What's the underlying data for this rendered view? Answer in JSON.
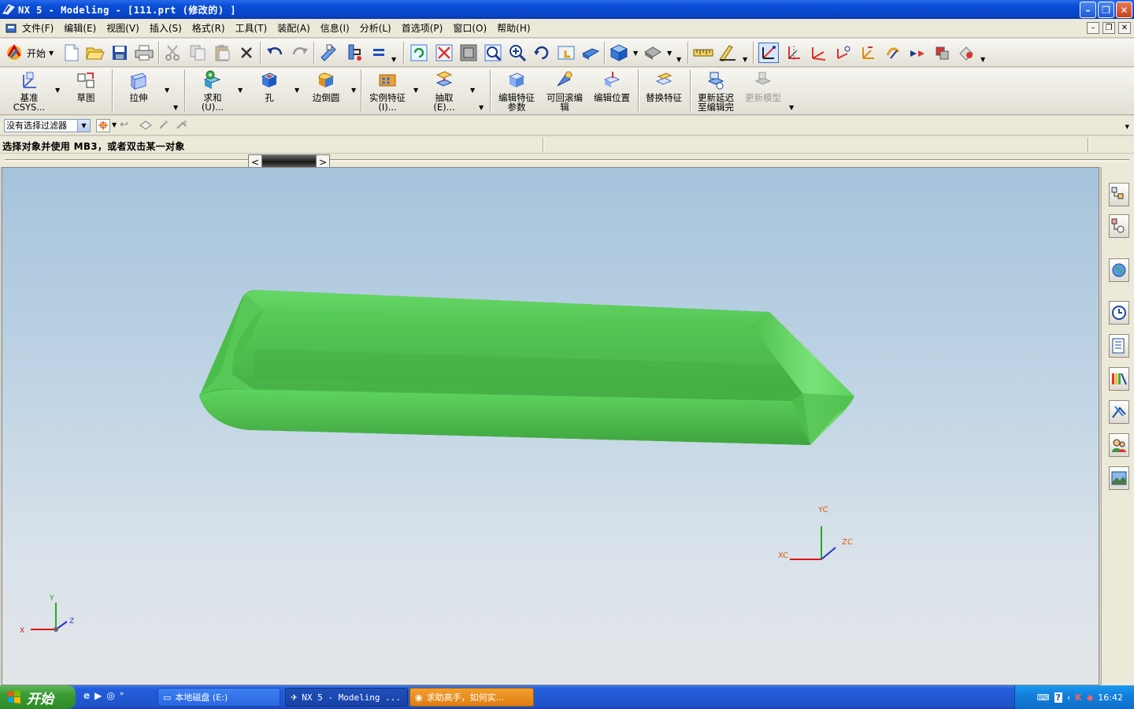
{
  "window": {
    "title": "NX 5 - Modeling - [111.prt  (修改的) ]",
    "buttons": [
      "minimize",
      "restore",
      "close"
    ]
  },
  "menubar": {
    "items": [
      "文件(F)",
      "编辑(E)",
      "视图(V)",
      "插入(S)",
      "格式(R)",
      "工具(T)",
      "装配(A)",
      "信息(I)",
      "分析(L)",
      "首选项(P)",
      "窗口(O)",
      "帮助(H)"
    ]
  },
  "toolbar_standard": {
    "start_label": "开始"
  },
  "toolbar_features": {
    "items": [
      {
        "label": "基准\nCSYS...",
        "icon": "datum-csys-icon"
      },
      {
        "label": "草图",
        "icon": "sketch-icon"
      },
      {
        "label": "拉伸",
        "icon": "extrude-icon"
      },
      {
        "label": "求和\n(U)...",
        "icon": "unite-icon"
      },
      {
        "label": "孔",
        "icon": "hole-icon"
      },
      {
        "label": "边倒圆",
        "icon": "edge-blend-icon"
      },
      {
        "label": "实例特征\n(I)...",
        "icon": "instance-feature-icon"
      },
      {
        "label": "抽取\n(E)...",
        "icon": "extract-icon"
      },
      {
        "label": "编辑特征\n参数",
        "icon": "edit-feature-params-icon"
      },
      {
        "label": "可回滚编\n辑",
        "icon": "rollback-edit-icon"
      },
      {
        "label": "编辑位置",
        "icon": "edit-position-icon"
      },
      {
        "label": "替换特征",
        "icon": "replace-feature-icon"
      },
      {
        "label": "更新延迟\n至编辑完",
        "icon": "delay-update-icon"
      },
      {
        "label": "更新模型",
        "icon": "update-model-icon",
        "disabled": true
      }
    ]
  },
  "selection": {
    "filter_value": "没有选择过滤器"
  },
  "status": {
    "prompt": "选择对象并使用 MB3，或者双击某一对象"
  },
  "viewport": {
    "model_color": "#4fc94f",
    "wcs_labels": {
      "x": "XC",
      "y": "YC",
      "z": "ZC"
    },
    "abs_labels": {
      "x": "X",
      "y": "Y",
      "z": "Z"
    }
  },
  "taskbar": {
    "start_label": "开始",
    "tasks": [
      {
        "label": "本地磁盘 (E:)",
        "state": "normal"
      },
      {
        "label": "NX 5 - Modeling ...",
        "state": "active"
      },
      {
        "label": "求助高手，如何实...",
        "state": "flash"
      }
    ],
    "clock": "16:42"
  }
}
